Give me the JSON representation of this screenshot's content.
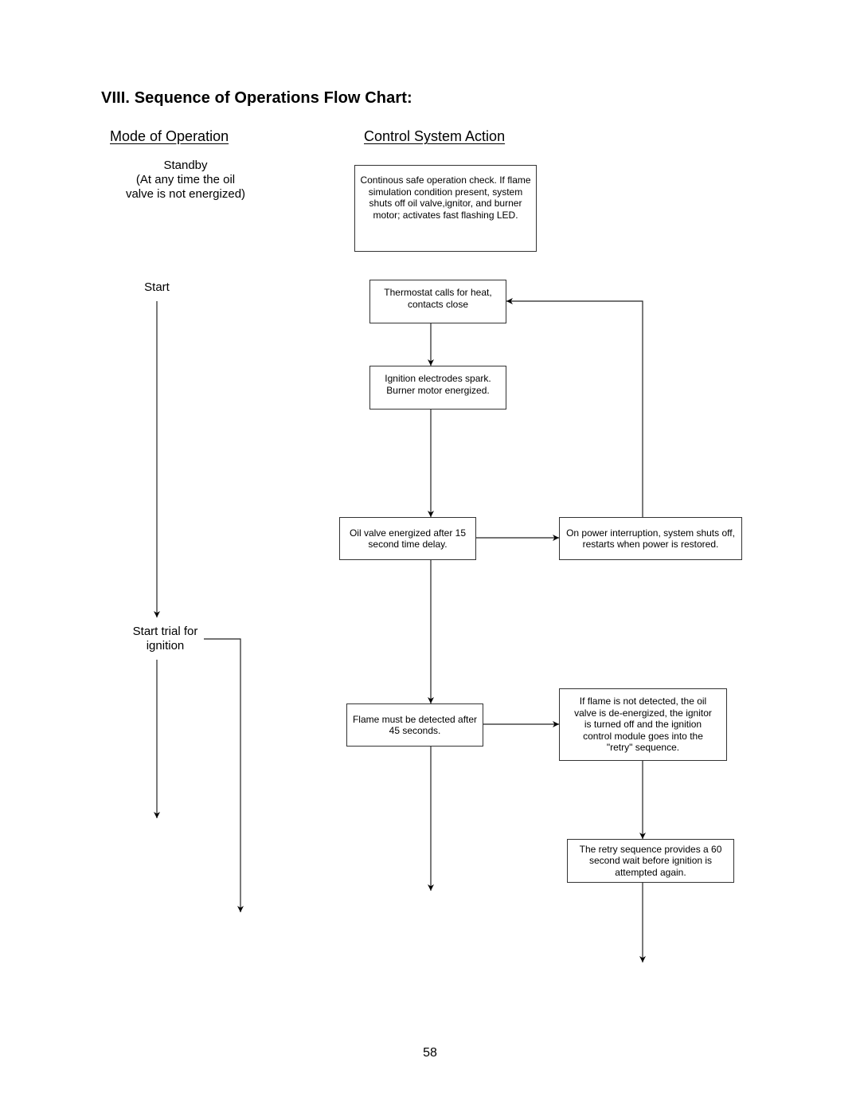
{
  "page": {
    "title": "VIII.  Sequence of Operations Flow Chart:",
    "page_number": "58"
  },
  "columns": {
    "mode_header": "Mode of Operation",
    "action_header": "Control System Action"
  },
  "modes": {
    "standby_line1": "Standby",
    "standby_line2": "(At any time the oil",
    "standby_line3": "valve is not energized)",
    "start": "Start",
    "trial_line1": "Start trial for",
    "trial_line2": "ignition"
  },
  "boxes": {
    "safe_check": "Continous safe operation check. If flame simulation condition present, system shuts off oil valve,ignitor, and burner motor; activates fast flashing LED.",
    "thermostat": "Thermostat calls for heat, contacts close",
    "ignition_spark": "Ignition electrodes spark. Burner motor energized.",
    "oil_valve": "Oil valve energized after 15 second time delay.",
    "power_interruption": "On power interruption, system shuts off, restarts when power is restored.",
    "flame_detect": "Flame must be detected after 45 seconds.",
    "flame_not_detected": "If flame is not detected, the oil valve is de-energized, the ignitor is turned off and the ignition control module goes into the \"retry\" sequence.",
    "retry": "The retry sequence provides a 60 second wait before ignition is attempted again."
  }
}
